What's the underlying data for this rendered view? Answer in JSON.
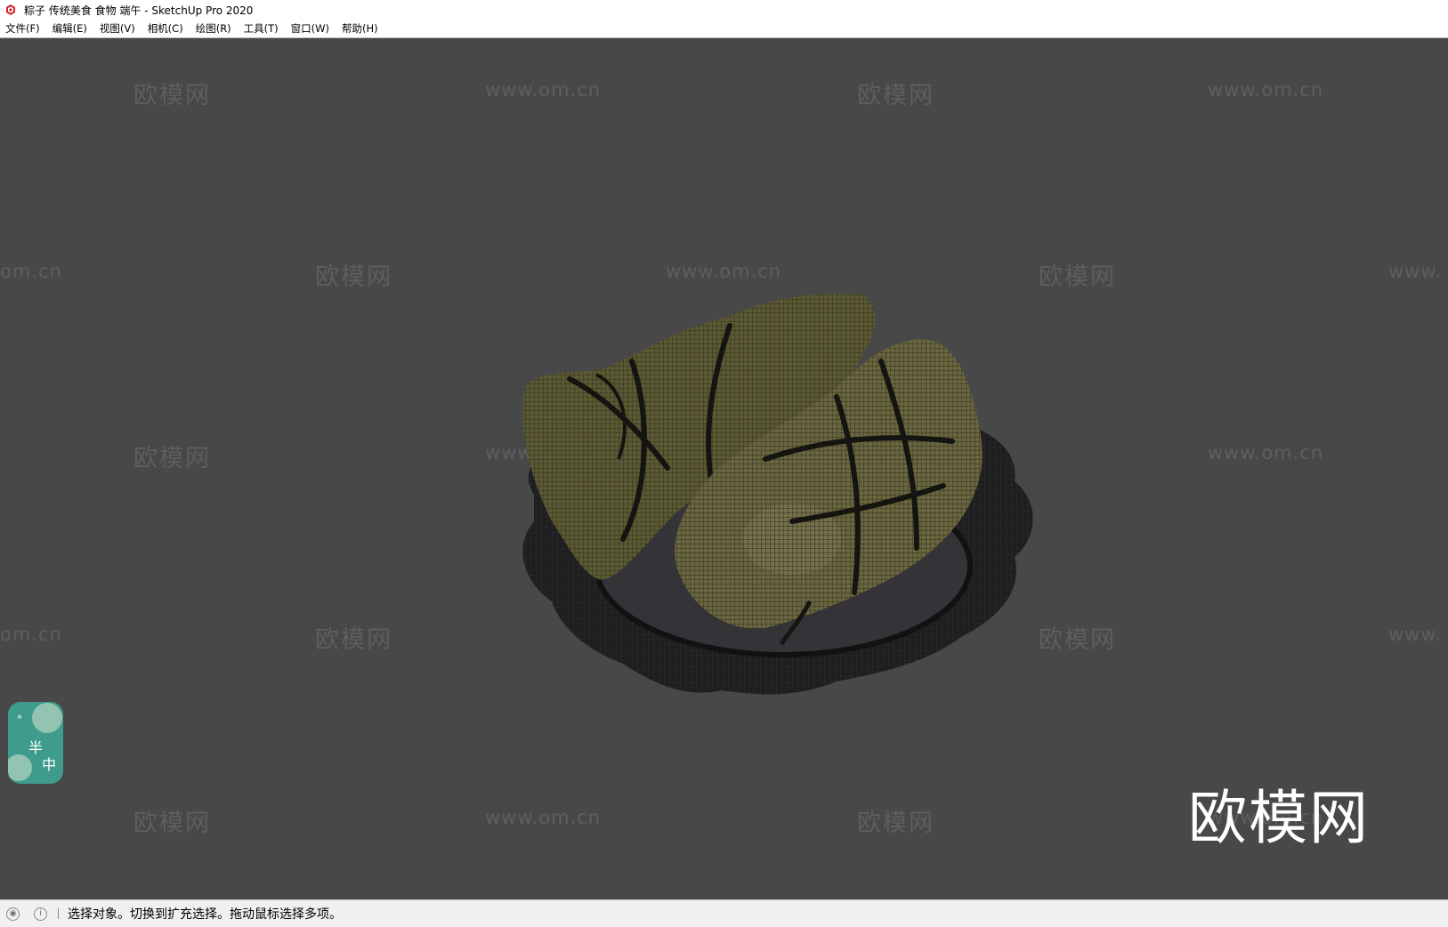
{
  "window": {
    "title": "粽子 传统美食 食物 端午 - SketchUp Pro 2020"
  },
  "menu": [
    "文件(F)",
    "编辑(E)",
    "视图(V)",
    "相机(C)",
    "绘图(R)",
    "工具(T)",
    "窗口(W)",
    "帮助(H)"
  ],
  "watermarks": {
    "cn": "欧模网",
    "url": "www.om.cn",
    "url_partial_left": "om.cn",
    "url_partial_right": "www."
  },
  "logo": "欧模网",
  "badge": {
    "char1": "半",
    "char2": "中",
    "char3": "°"
  },
  "status": {
    "message": "选择对象。切换到扩充选择。拖动鼠标选择多项。"
  },
  "icons": {
    "app": "sketchup-icon",
    "status_geo": "geo-location-icon",
    "status_info": "info-icon"
  }
}
